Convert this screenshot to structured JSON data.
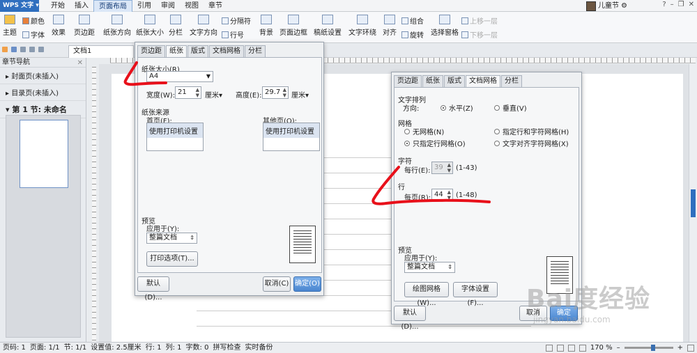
{
  "app": {
    "name": "WPS 文字"
  },
  "menu": [
    {
      "label": "开始",
      "active": false
    },
    {
      "label": "插入",
      "active": false
    },
    {
      "label": "页面布局",
      "active": true
    },
    {
      "label": "引用",
      "active": false
    },
    {
      "label": "审阅",
      "active": false
    },
    {
      "label": "视图",
      "active": false
    },
    {
      "label": "章节",
      "active": false
    }
  ],
  "user": {
    "name": "儿童节"
  },
  "ribbon": {
    "color": "颜色",
    "theme": "主题",
    "font": "字体",
    "effect": "效果",
    "margins": "页边距",
    "orientation": "纸张方向",
    "size": "纸张大小",
    "columns": "分栏",
    "text_direction": "文字方向",
    "separator": "分隔符",
    "line_number": "行号",
    "background": "背景",
    "page_border": "页面边框",
    "paper_setup": "稿纸设置",
    "wrap": "文字环绕",
    "align": "对齐",
    "group": "组合",
    "rotate": "旋转",
    "selection_pane": "选择窗格",
    "bring_forward": "上移一层",
    "send_backward": "下移一层"
  },
  "tabstrip": {
    "doc_tab": "文档1"
  },
  "nav": {
    "title": "章节导航",
    "items": [
      "封面页(未插入)",
      "目录页(未插入)",
      "第 1 节: 未命名"
    ]
  },
  "status": {
    "page": "页码: 1",
    "pages": "页面: 1/1",
    "section": "节: 1/1",
    "setting": "设置值: 2.5厘米",
    "row": "行: 1",
    "col": "列: 1",
    "words": "字数: 0",
    "spell": "拼写检查",
    "backup": "实时备份",
    "zoom": "170 %"
  },
  "dlg1": {
    "tabs": [
      "页边距",
      "纸张",
      "版式",
      "文档网格",
      "分栏"
    ],
    "active_tab": 1,
    "paper_size_label": "纸张大小(R)",
    "paper_size_value": "A4",
    "width_label": "宽度(W):",
    "width_value": "21",
    "unit1": "厘米",
    "height_label": "高度(E):",
    "height_value": "29.7",
    "unit2": "厘米",
    "source_label": "纸张来源",
    "first_page_label": "首页(F):",
    "first_page_value": "使用打印机设置",
    "other_pages_label": "其他页(O):",
    "other_pages_value": "使用打印机设置",
    "preview_label": "预览",
    "apply_label": "应用于(Y):",
    "apply_value": "整篇文档",
    "print_options": "打印选项(T)...",
    "default_btn": "默认(D)...",
    "cancel_btn": "取消(C)",
    "ok_btn": "确定(O)"
  },
  "dlg2": {
    "tabs": [
      "页边距",
      "纸张",
      "版式",
      "文档网格",
      "分栏"
    ],
    "active_tab": 3,
    "text_arrange": "文字排列",
    "direction_label": "方向:",
    "horizontal": "水平(Z)",
    "vertical": "垂直(V)",
    "grid_label": "网格",
    "no_grid": "无网格(N)",
    "line_char_grid": "指定行和字符网格(H)",
    "line_grid_only": "只指定行网格(O)",
    "text_align_grid": "文字对齐字符网格(X)",
    "char_label": "字符",
    "per_line_label": "每行(E):",
    "per_line_value": "39",
    "per_line_range": "(1-43)",
    "line_label": "行",
    "per_page_label": "每页(R):",
    "per_page_value": "44",
    "per_page_range": "(1-48)",
    "preview_label": "预览",
    "apply_label": "应用于(Y):",
    "apply_value": "整篇文档",
    "draw_grid": "绘图网格(W)...",
    "font_setting": "字体设置(F)...",
    "default_btn": "默认(D)...",
    "cancel_btn": "取消",
    "ok_btn": "确定"
  },
  "watermark": {
    "logo": "Bai度经验",
    "url": "jingyan.baidu.com"
  },
  "colors": {
    "accent": "#2f6fbf",
    "annotation": "#e8101a"
  }
}
